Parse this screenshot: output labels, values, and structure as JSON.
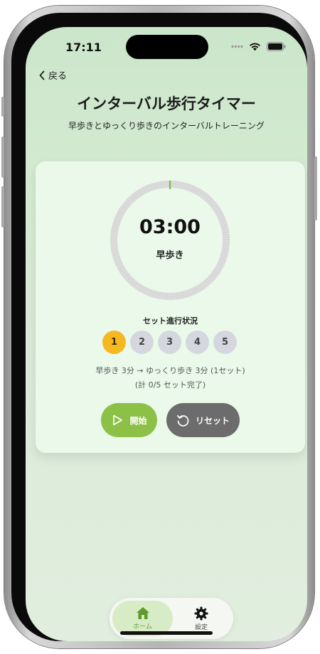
{
  "status_bar": {
    "time": "17:11",
    "icons": [
      "cellular-icon",
      "wifi-icon",
      "battery-icon"
    ]
  },
  "nav": {
    "back_label": "戻る",
    "back_icon": "chevron-left-icon"
  },
  "header": {
    "title": "インターバル歩行タイマー",
    "subtitle": "早歩きとゆっくり歩きのインターバルトレーニング"
  },
  "timer": {
    "display": "03:00",
    "phase": "早歩き",
    "ring_progress": 0.0,
    "ring_color": "#d6d6d6",
    "ring_accent_color": "#7dbb3f"
  },
  "sets": {
    "label": "セット進行状況",
    "items": [
      "1",
      "2",
      "3",
      "4",
      "5"
    ],
    "current": 1,
    "active_color": "#f5b820",
    "inactive_color": "#d4d8de"
  },
  "description": {
    "line1": "早歩き 3分 → ゆっくり歩き 3分 (1セット)",
    "line2": "(計 0/5 セット完了)"
  },
  "controls": {
    "start_label": "開始",
    "start_icon": "play-icon",
    "start_color": "#8cc047",
    "reset_label": "リセット",
    "reset_icon": "reset-icon",
    "reset_color": "#6c6c6c"
  },
  "tab_bar": {
    "tabs": [
      {
        "label": "ホーム",
        "icon": "home-icon",
        "selected": true
      },
      {
        "label": "設定",
        "icon": "gear-icon",
        "selected": false
      }
    ],
    "accent_color": "#5e9a2c"
  }
}
